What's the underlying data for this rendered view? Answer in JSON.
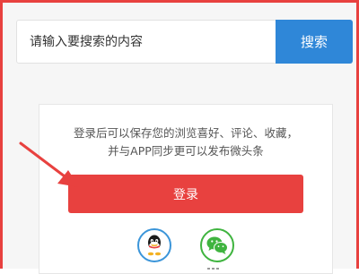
{
  "search": {
    "placeholder": "请输入要搜索的内容",
    "button_label": "搜索"
  },
  "login_card": {
    "prompt_line1": "登录后可以保存您的浏览喜好、评论、收藏，",
    "prompt_line2": "并与APP同步更可以发布微头条",
    "login_label": "登录",
    "social_icons": [
      "qq-icon",
      "wechat-icon"
    ]
  },
  "colors": {
    "accent_red": "#e8413f",
    "search_blue": "#2f87d8",
    "qq_blue": "#3b95d9",
    "wechat_green": "#3fb43f"
  }
}
